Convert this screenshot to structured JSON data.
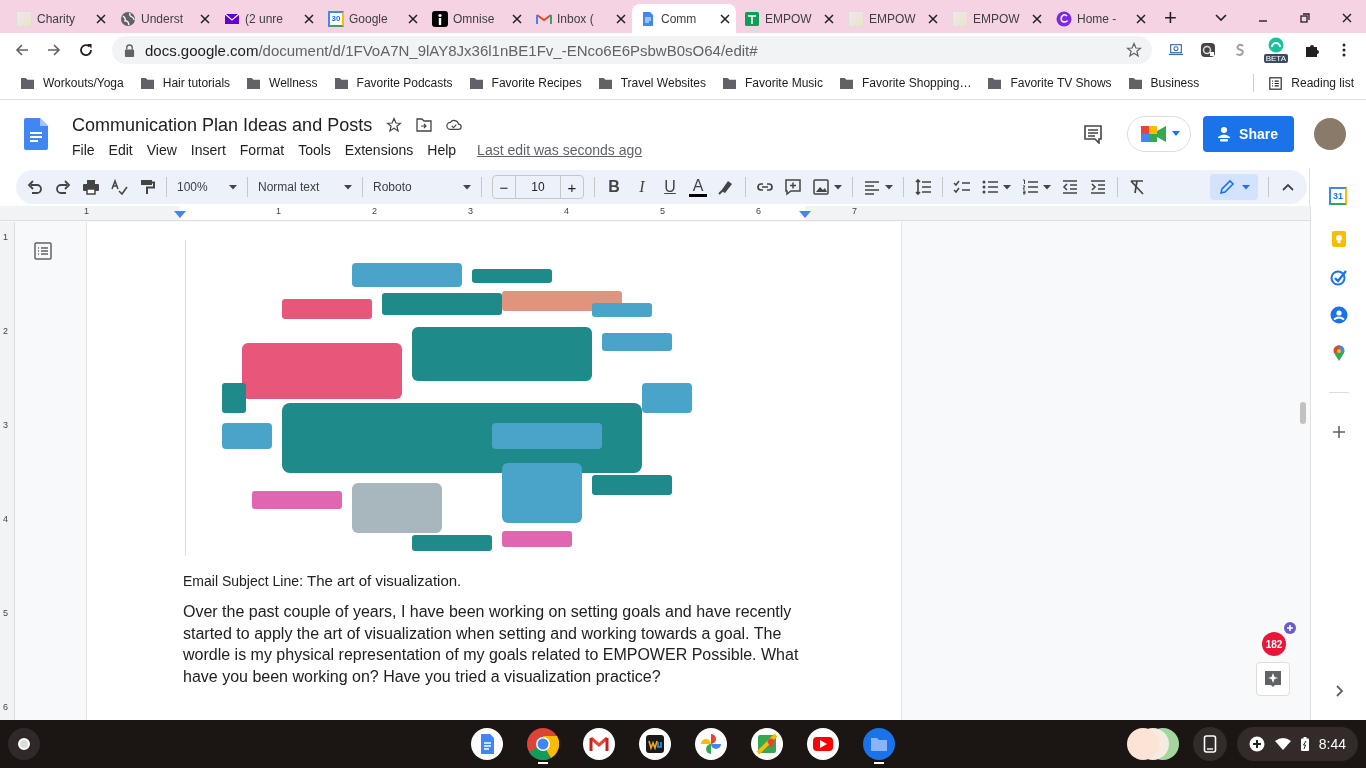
{
  "browser": {
    "tabs": [
      {
        "title": "Charity",
        "kind": "photo",
        "selected": false
      },
      {
        "title": "Underst",
        "kind": "globe",
        "selected": false
      },
      {
        "title": "(2 unre",
        "kind": "mail",
        "selected": false
      },
      {
        "title": "Google",
        "kind": "calendar",
        "icon_text": "30",
        "selected": false
      },
      {
        "title": "Omnise",
        "kind": "figure",
        "selected": false
      },
      {
        "title": "Inbox (",
        "kind": "gmail",
        "selected": false
      },
      {
        "title": "Comm",
        "kind": "docs",
        "selected": true
      },
      {
        "title": "EMPOW",
        "kind": "sheets",
        "selected": false
      },
      {
        "title": "EMPOW",
        "kind": "photo",
        "selected": false
      },
      {
        "title": "EMPOW",
        "kind": "photo",
        "selected": false
      },
      {
        "title": "Home -",
        "kind": "swirl",
        "selected": false
      }
    ],
    "new_tab": "+",
    "address": {
      "domain": "docs.google.com",
      "path": "/document/d/1FVoA7N_9lAY8Jx36l1nBE1Fv_-ENco6E6PsbwB0sO64/edit#"
    },
    "extension_badge": "BETA",
    "bookmarks": [
      "Workouts/Yoga",
      "Hair tutorials",
      "Wellness",
      "Favorite Podcasts",
      "Favorite Recipes",
      "Travel Websites",
      "Favorite Music",
      "Favorite Shopping…",
      "Favorite TV Shows",
      "Business"
    ],
    "reading_list": "Reading list"
  },
  "doc": {
    "title": "Communication Plan Ideas and Posts",
    "menus": [
      "File",
      "Edit",
      "View",
      "Insert",
      "Format",
      "Tools",
      "Extensions",
      "Help"
    ],
    "last_edit": "Last edit was seconds ago",
    "share": "Share",
    "toolbar": {
      "zoom": "100%",
      "style": "Normal text",
      "font": "Roboto",
      "minus": "−",
      "size": "10",
      "plus": "+",
      "bold": "B",
      "italic": "I",
      "underline": "U",
      "text_color": "A"
    },
    "ruler": {
      "horizontal": [
        "1",
        "1",
        "2",
        "3",
        "4",
        "5",
        "6",
        "7"
      ],
      "vertical": [
        "1",
        "2",
        "3",
        "4",
        "5",
        "6"
      ]
    },
    "subject_label": "Email Subject Line",
    "subject_text": ": The art of visualization.",
    "body": " Over the past couple of years, I have been working on setting goals and have recently started to apply the art of visualization when setting and working towards a goal. The wordle is my physical representation of my goals related to EMPOWER Possible. What have you been working on? Have you tried a visualization practice?",
    "notification_count": "182"
  },
  "side_panel": {
    "calendar_day": "31"
  },
  "shelf": {
    "apps": [
      {
        "kind": "docs",
        "running": false
      },
      {
        "kind": "chrome",
        "running": true
      },
      {
        "kind": "gmail",
        "running": false
      },
      {
        "kind": "wu",
        "running": false
      },
      {
        "kind": "photos",
        "running": false
      },
      {
        "kind": "maps",
        "running": false
      },
      {
        "kind": "youtube",
        "running": false
      },
      {
        "kind": "files",
        "running": true
      }
    ],
    "time": "8:44"
  }
}
